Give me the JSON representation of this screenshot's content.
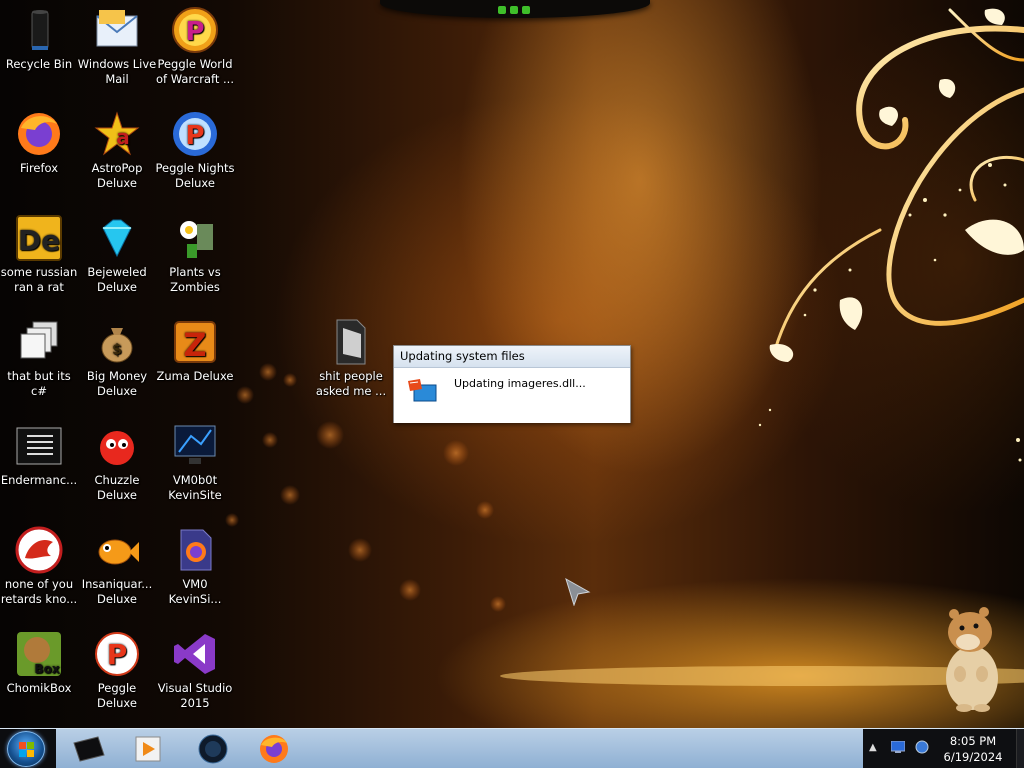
{
  "desktop": {
    "icons": [
      {
        "label": "Recycle Bin",
        "icon": "recycle-bin-icon"
      },
      {
        "label": "Windows Live\nMail",
        "icon": "mail-icon"
      },
      {
        "label": "Peggle World\nof Warcraft ...",
        "icon": "peggle-icon"
      },
      {
        "label": "Firefox",
        "icon": "firefox-icon"
      },
      {
        "label": "AstroPop\nDeluxe",
        "icon": "astropop-icon"
      },
      {
        "label": "Peggle Nights\nDeluxe",
        "icon": "peggle-nights-icon"
      },
      {
        "label": "some russian\nran a rat",
        "icon": "de-icon"
      },
      {
        "label": "Bejeweled\nDeluxe",
        "icon": "gem-icon"
      },
      {
        "label": "Plants vs\nZombies",
        "icon": "plants-vs-zombies-icon"
      },
      {
        "label": "that but its c#",
        "icon": "windows-stack-icon"
      },
      {
        "label": "Big Money\nDeluxe",
        "icon": "money-bag-icon"
      },
      {
        "label": "Zuma Deluxe",
        "icon": "zuma-icon"
      },
      {
        "label": "Endermanc...",
        "icon": "console-app-icon"
      },
      {
        "label": "Chuzzle\nDeluxe",
        "icon": "chuzzle-icon"
      },
      {
        "label": "VM0b0t\nKevinSite",
        "icon": "vm-screen-icon"
      },
      {
        "label": "none of you\nretards kno...",
        "icon": "dino-icon"
      },
      {
        "label": "Insaniquar...\nDeluxe",
        "icon": "fish-icon"
      },
      {
        "label": "VM0\nKevinSi...",
        "icon": "firefox-file-icon"
      },
      {
        "label": "ChomikBox",
        "icon": "chomikbox-icon"
      },
      {
        "label": "Peggle Deluxe",
        "icon": "peggle-deluxe-icon"
      },
      {
        "label": "Visual Studio\n2015",
        "icon": "visual-studio-icon"
      },
      {
        "label": "shit people\nasked me ...",
        "icon": "folder-icon"
      }
    ]
  },
  "dialog": {
    "title": "Updating system files",
    "message": "Updating imageres.dll..."
  },
  "taskbar": {
    "start_icon": "windows-logo-icon",
    "pinned": [
      {
        "icon": "terminal-icon"
      },
      {
        "icon": "media-player-icon"
      },
      {
        "icon": "dark-orb-icon"
      },
      {
        "icon": "firefox-icon"
      }
    ],
    "tray": {
      "expand_glyph": "▲",
      "time": "8:05 PM",
      "date": "6/19/2024"
    }
  },
  "colors": {
    "taskbar": "#a7c2de",
    "dialog_title_bg": "#dce6f1",
    "wallpaper_accent": "#f6b64a"
  }
}
